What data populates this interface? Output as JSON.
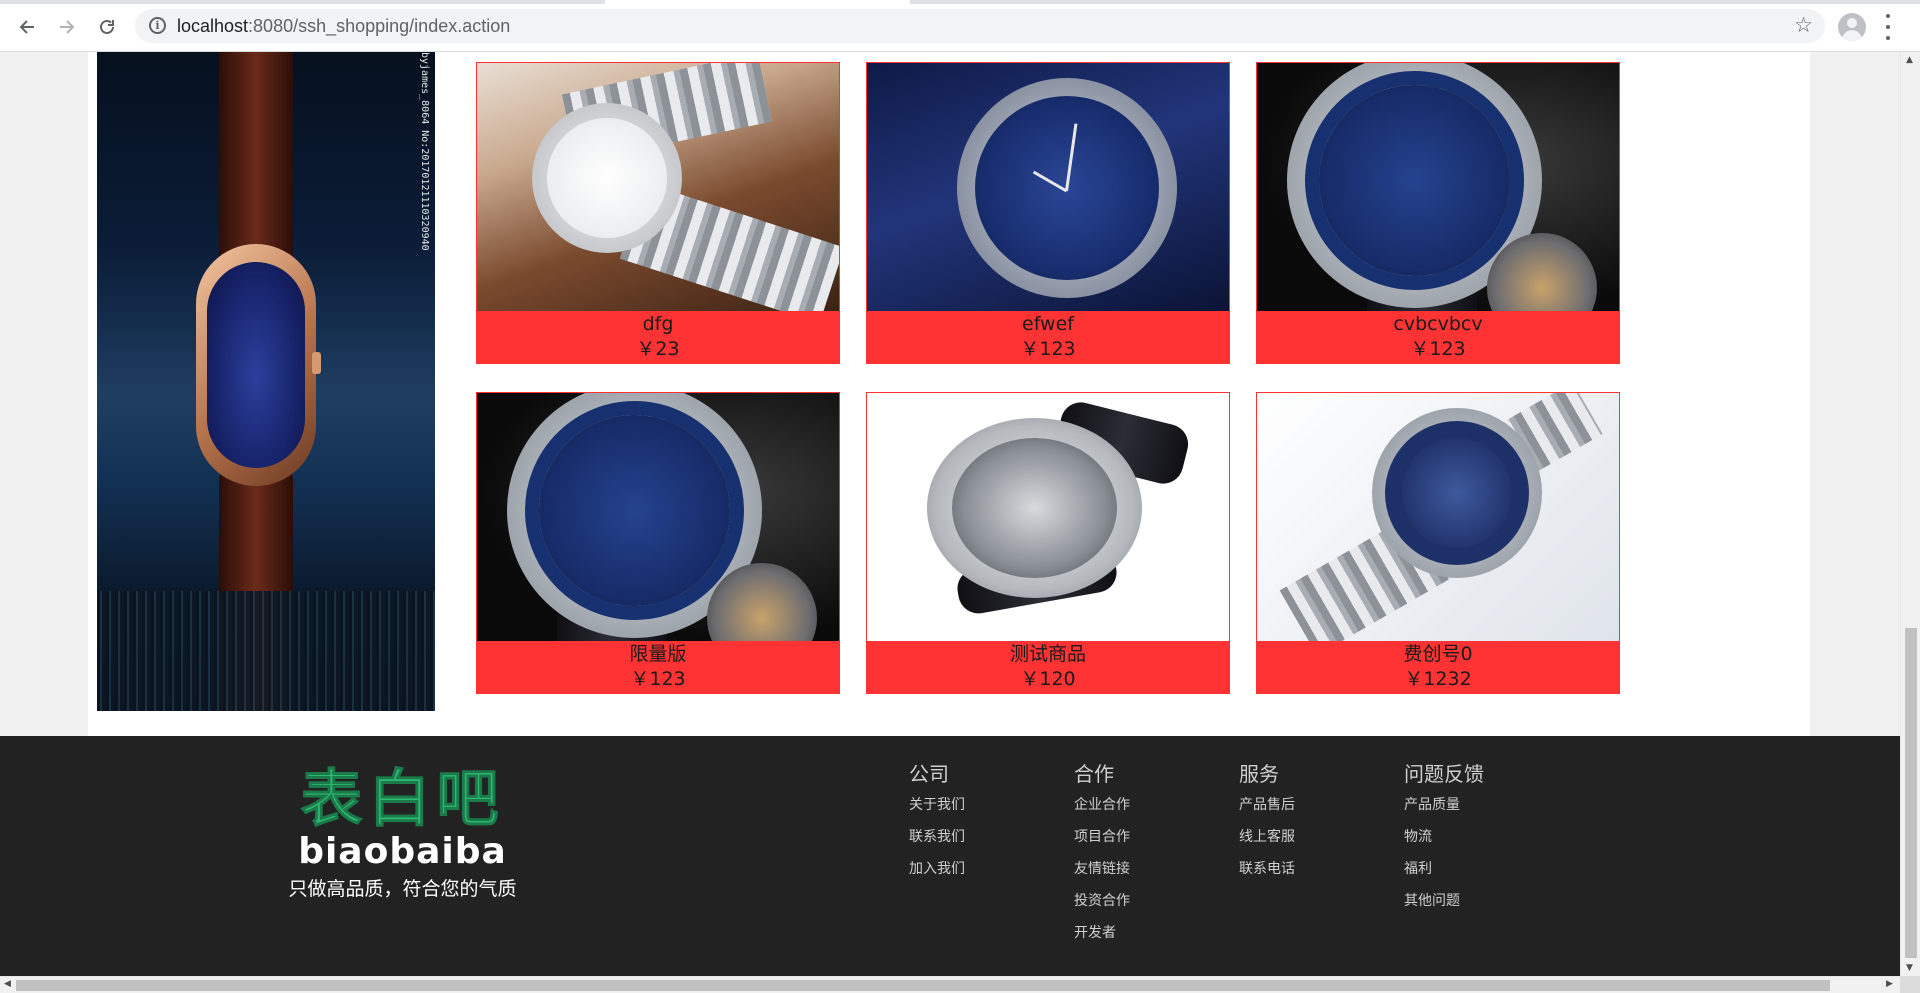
{
  "browser": {
    "url_host": "localhost",
    "url_path": ":8080/ssh_shopping/index.action",
    "icons": {
      "back": "back-arrow-icon",
      "forward": "forward-arrow-icon",
      "reload": "reload-icon",
      "info": "info-icon",
      "bookmark": "star-icon",
      "profile": "profile-icon",
      "menu": "more-vert-icon"
    }
  },
  "promo": {
    "watermark": "byjames_8064 No:20170121110320940"
  },
  "products": [
    {
      "name": "dfg",
      "price": "￥23"
    },
    {
      "name": "efwef",
      "price": "￥123"
    },
    {
      "name": "cvbcvbcv",
      "price": "￥123"
    },
    {
      "name": "限量版",
      "price": "￥123"
    },
    {
      "name": "测试商品",
      "price": "￥120"
    },
    {
      "name": "费创号0",
      "price": "￥1232"
    }
  ],
  "footer": {
    "logo_cn": "表白吧",
    "logo_en": "biaobaiba",
    "slogan": "只做高品质，符合您的气质",
    "columns": [
      {
        "title": "公司",
        "links": [
          "关于我们",
          "联系我们",
          "加入我们"
        ]
      },
      {
        "title": "合作",
        "links": [
          "企业合作",
          "项目合作",
          "友情链接",
          "投资合作",
          "开发者"
        ]
      },
      {
        "title": "服务",
        "links": [
          "产品售后",
          "线上客服",
          "联系电话"
        ]
      },
      {
        "title": "问题反馈",
        "links": [
          "产品质量",
          "物流",
          "福利",
          "其他问题"
        ]
      }
    ]
  },
  "colors": {
    "caption_red": "#ff3333",
    "footer_bg": "#222222",
    "logo_green": "#2eb872"
  }
}
